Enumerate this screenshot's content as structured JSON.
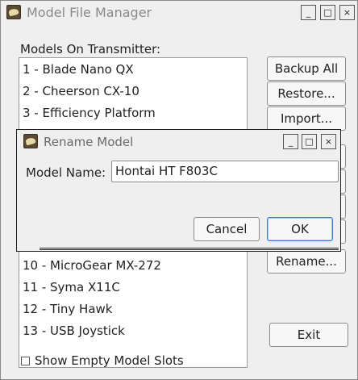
{
  "window": {
    "title": "Model File Manager",
    "controls": {
      "minimize": "_",
      "maximize": "□",
      "close": "×"
    }
  },
  "models_label": "Models On Transmitter:",
  "models": [
    "1 - Blade Nano QX",
    "2 - Cheerson CX-10",
    "3 - Efficiency Platform",
    "10 - MicroGear MX-272",
    "11 - Syma X11C",
    "12 - Tiny Hawk",
    "13 - USB Joystick"
  ],
  "buttons": {
    "backup_all": "Backup All",
    "restore": "Restore...",
    "import": "Import...",
    "rename": "Rename...",
    "exit": "Exit"
  },
  "show_empty_slots": {
    "label": "Show Empty Model Slots",
    "checked": false
  },
  "dialog": {
    "title": "Rename Model",
    "controls": {
      "minimize": "_",
      "maximize": "□",
      "close": "×"
    },
    "field_label": "Model Name:",
    "field_value": "Hontai HT F803C",
    "cancel": "Cancel",
    "ok": "OK"
  },
  "colors": {
    "window_bg": "#efefef",
    "default_button_border": "#3c7ad4"
  },
  "icons": {
    "app": "app-icon"
  }
}
